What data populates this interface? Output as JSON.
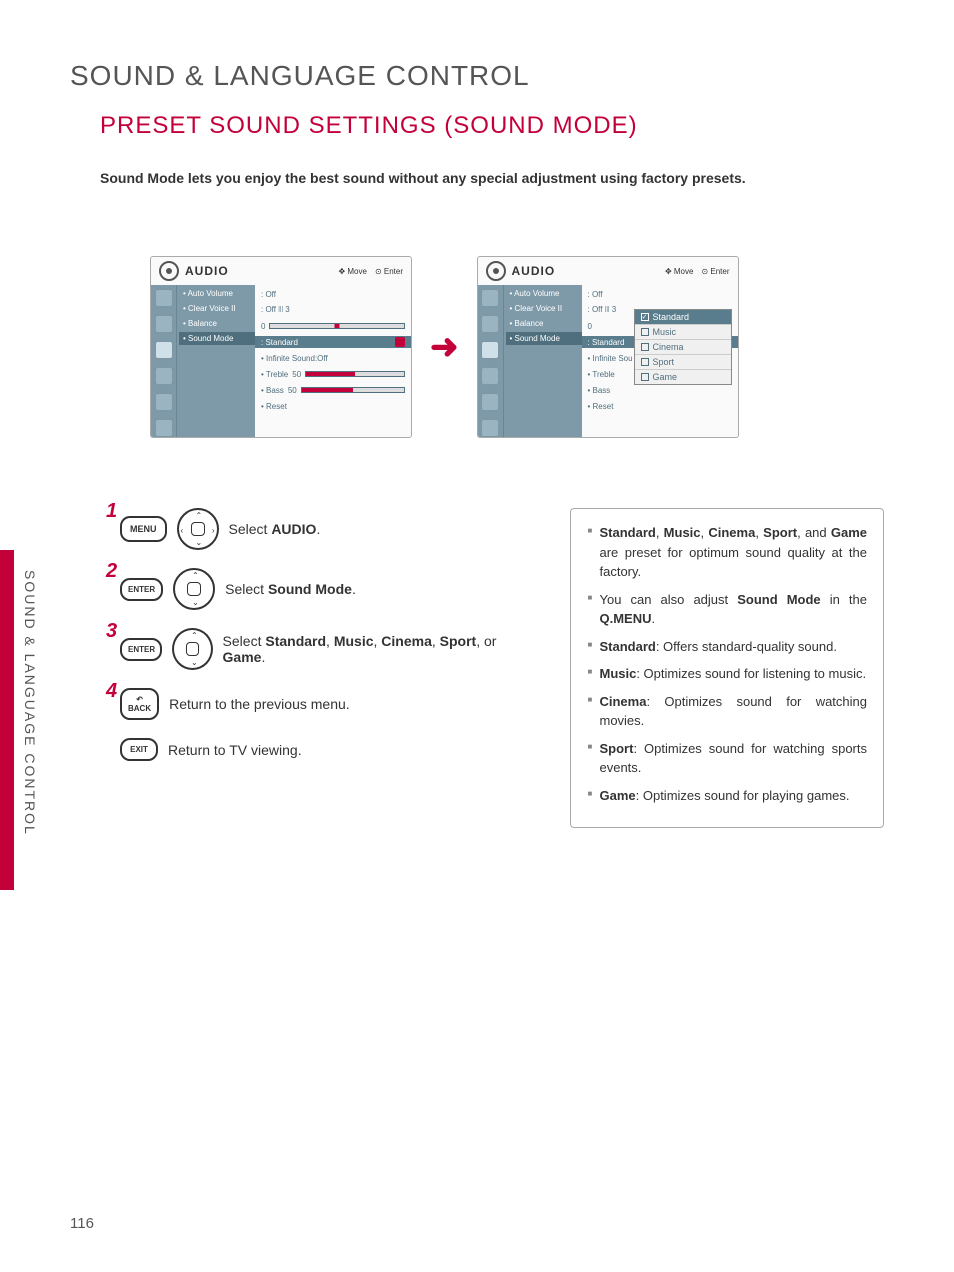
{
  "page_number": "116",
  "side_label": "SOUND & LANGUAGE CONTROL",
  "h1": "SOUND & LANGUAGE CONTROL",
  "h2": "PRESET SOUND SETTINGS (SOUND MODE)",
  "intro": "Sound Mode lets you enjoy the best sound without any special adjustment using factory presets.",
  "osd": {
    "title": "AUDIO",
    "hints_move": "Move",
    "hints_enter": "Enter",
    "labels": [
      "• Auto Volume",
      "• Clear Voice II",
      "• Balance",
      "• Sound Mode"
    ],
    "sub_labels": [
      "• Infinite Sound:Off",
      "• Treble",
      "• Bass",
      "• Reset"
    ],
    "sub_labels_b": [
      "• Infinite Sou",
      "• Treble",
      "• Bass",
      "• Reset"
    ],
    "vals": {
      "auto_volume": ": Off",
      "clear_voice": ": Off ꔖ 3",
      "balance": "0",
      "sound_mode": ": Standard",
      "treble": "50",
      "bass": "50"
    },
    "dropdown": [
      "Standard",
      "Music",
      "Cinema",
      "Sport",
      "Game"
    ]
  },
  "steps": {
    "s1": {
      "btn": "MENU",
      "text_a": "Select ",
      "text_b": "AUDIO",
      "text_c": "."
    },
    "s2": {
      "btn": "ENTER",
      "text_a": "Select ",
      "text_b": "Sound Mode",
      "text_c": "."
    },
    "s3": {
      "btn": "ENTER",
      "text_a": "Select ",
      "b1": "Standard",
      "t2": ", ",
      "b2": "Music",
      "t3": ", ",
      "b3": "Cinema",
      "t4": ", ",
      "b4": "Sport",
      "t5": ", or ",
      "b5": "Game",
      "t6": "."
    },
    "s4": {
      "btn": "BACK",
      "text": "Return to the previous menu."
    },
    "s5": {
      "btn": "EXIT",
      "text": "Return to TV viewing."
    }
  },
  "info": {
    "i1_a": "Standard",
    "i1_b": ", ",
    "i1_c": "Music",
    "i1_d": ", ",
    "i1_e": "Cinema",
    "i1_f": ", ",
    "i1_g": "Sport",
    "i1_h": ", and ",
    "i1_i": "Game",
    "i1_j": " are preset for optimum sound quality at the factory.",
    "i2_a": "You can also adjust ",
    "i2_b": "Sound Mode",
    "i2_c": " in the ",
    "i2_d": "Q.MENU",
    "i2_e": ".",
    "i3_a": "Standard",
    "i3_b": ": Offers standard-quality sound.",
    "i4_a": "Music",
    "i4_b": ": Optimizes sound for listening to music.",
    "i5_a": "Cinema",
    "i5_b": ": Optimizes sound for watching movies.",
    "i6_a": "Sport",
    "i6_b": ": Optimizes sound for watching sports events.",
    "i7_a": "Game",
    "i7_b": ": Optimizes sound for playing games."
  }
}
